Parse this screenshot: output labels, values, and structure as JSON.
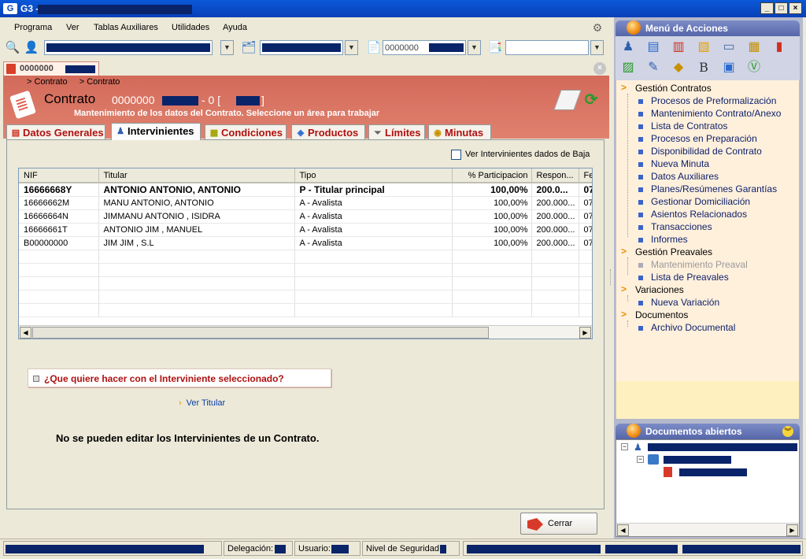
{
  "window": {
    "title": "G3 -",
    "minimize": "_",
    "maximize": "□",
    "close": "×"
  },
  "menubar": {
    "items": [
      "Programa",
      "Ver",
      "Tablas Auxiliares",
      "Utilidades",
      "Ayuda"
    ]
  },
  "toolbar": {
    "field3_value": "0000000"
  },
  "doc_tab": {
    "label": "0000000"
  },
  "breadcrumb": [
    "> Contrato",
    "> Contrato"
  ],
  "header": {
    "title": "Contrato",
    "number": "0000000",
    "separator": "- 0 [",
    "close_bracket": "]",
    "subtitle": "Mantenimiento de los datos del Contrato. Seleccione un área para trabajar"
  },
  "tabs": [
    {
      "label": "Datos Generales",
      "icon": "document-icon"
    },
    {
      "label": "Intervinientes",
      "icon": "person-icon"
    },
    {
      "label": "Condiciones",
      "icon": "page-icon"
    },
    {
      "label": "Productos",
      "icon": "cube-icon"
    },
    {
      "label": "Límites",
      "icon": "funnel-icon"
    },
    {
      "label": "Minutas",
      "icon": "coins-icon"
    }
  ],
  "active_tab": "Intervinientes",
  "baja_checkbox": {
    "label": "Ver Intervinientes dados de Baja",
    "checked": false
  },
  "grid": {
    "columns": [
      "NIF",
      "Titular",
      "Tipo",
      "% Participacion",
      "Respon...",
      "Fe"
    ],
    "rows": [
      [
        "16666668Y",
        "ANTONIO  ANTONIO, ANTONIO",
        "P - Titular principal",
        "100,00%",
        "200.0...",
        "07"
      ],
      [
        "16666662M",
        "MANU ANTONIO, ANTONIO",
        "A - Avalista",
        "100,00%",
        "200.000...",
        "07"
      ],
      [
        "16666664N",
        "JIMMANU ANTONIO , ISIDRA",
        "A - Avalista",
        "100,00%",
        "200.000...",
        "07"
      ],
      [
        "16666661T",
        "ANTONIO JIM , MANUEL",
        "A - Avalista",
        "100,00%",
        "200.000...",
        "07"
      ],
      [
        "B00000000",
        "JIM JIM , S.L",
        "A - Avalista",
        "100,00%",
        "200.000...",
        "07"
      ]
    ]
  },
  "action_panel": {
    "question": "¿Que quiere hacer con el Interviniente seleccionado?",
    "link": "Ver Titular",
    "notice": "No se pueden editar los Intervinientes de un Contrato."
  },
  "close_button": "Cerrar",
  "right_panel": {
    "actions_title": "Menú de Acciones",
    "groups": [
      {
        "label": "Gestión Contratos",
        "items": [
          "Procesos de Preformalización",
          "Mantenimiento Contrato/Anexo",
          "Lista de Contratos",
          "Procesos en Preparación",
          "Disponibilidad de Contrato",
          "Nueva Minuta",
          "Datos Auxiliares",
          "Planes/Resúmenes Garantías",
          "Gestionar Domiciliación",
          "Asientos Relacionados",
          "Transacciones",
          "Informes"
        ]
      },
      {
        "label": "Gestión Preavales",
        "items": [
          "Mantenimiento Preaval",
          "Lista de Preavales"
        ]
      },
      {
        "label": "Variaciones",
        "items": [
          "Nueva Variación"
        ]
      },
      {
        "label": "Documentos",
        "items": [
          "Archivo Documental"
        ]
      }
    ],
    "disabled_items": [
      "Mantenimiento Preaval"
    ],
    "open_docs_title": "Documentos abiertos"
  },
  "statusbar": {
    "delegacion_label": "Delegación:",
    "usuario_label": "Usuario:",
    "seguridad_label": "Nivel de Seguridad:"
  },
  "colors": {
    "titlebar": "#0840b8",
    "header_band": "#d36a5a",
    "tab_text": "#b01010",
    "link": "#0b3ea8",
    "redaction": "#0a246a",
    "action_tree_bg": "#fff0dc"
  }
}
